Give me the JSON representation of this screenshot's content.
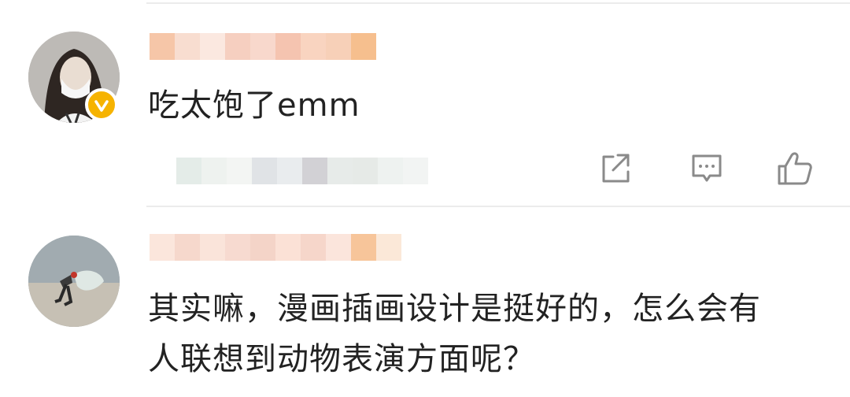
{
  "comments": [
    {
      "avatar_icon": "avatar-woman-mask",
      "verified_badge": true,
      "badge_color": "#f6b300",
      "text_lines": [
        "吃太饱了emm"
      ],
      "actions": [
        "share-icon",
        "comment-icon",
        "like-icon"
      ]
    },
    {
      "avatar_icon": "avatar-person-beach",
      "verified_badge": false,
      "text_lines": [
        "其实嘛，漫画插画设计是挺好的，怎么会有",
        "人联想到动物表演方面呢？"
      ]
    }
  ],
  "colors": {
    "text": "#222222",
    "icon": "#8a8a8a",
    "divider": "#ececec"
  }
}
